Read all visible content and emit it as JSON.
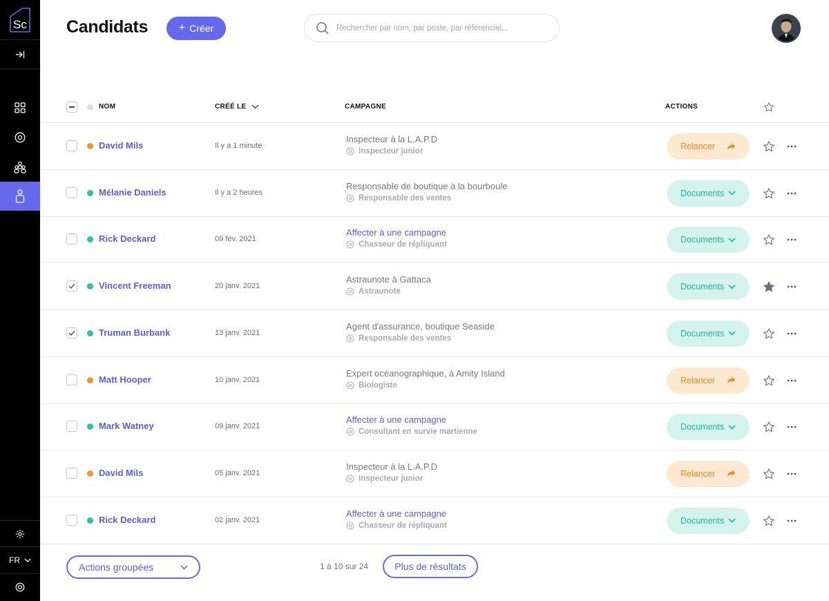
{
  "app": {
    "logo_text": "Sc",
    "page_title": "Candidats",
    "create_label": "Créer",
    "search_placeholder": "Rechercher par nom, par poste, par référenciel..."
  },
  "sidebar": {
    "items": [
      {
        "icon": "dashboard-icon",
        "active": false
      },
      {
        "icon": "target-icon",
        "active": false
      },
      {
        "icon": "team-icon",
        "active": false
      },
      {
        "icon": "candidate-icon",
        "active": true
      }
    ],
    "settings_icon": "settings-icon",
    "language": "FR",
    "support_icon": "support-icon"
  },
  "table": {
    "headers": {
      "name": "NOM",
      "created": "CRÉÉ LE",
      "campaign": "CAMPAGNE",
      "actions": "ACTIONS"
    },
    "rows": [
      {
        "checked": false,
        "status": "orange",
        "name": "David Mils",
        "created": "Il y a 1 minute",
        "campaign": "Inspecteur à la L.A.P.D",
        "campaign_link": false,
        "role": "Inspecteur junior",
        "action": "Relancer",
        "action_type": "relancer",
        "starred": false
      },
      {
        "checked": false,
        "status": "teal",
        "name": "Mélanie Daniels",
        "created": "Il y a 2 heures",
        "campaign": "Responsable de boutique à la bourboule",
        "campaign_link": false,
        "role": "Responsable des ventes",
        "action": "Documents",
        "action_type": "documents",
        "starred": false
      },
      {
        "checked": false,
        "status": "teal",
        "name": "Rick Deckard",
        "created": "09 fév. 2021",
        "campaign": "Affecter à une campagne",
        "campaign_link": true,
        "role": "Chasseur de répliquant",
        "action": "Documents",
        "action_type": "documents",
        "starred": false
      },
      {
        "checked": true,
        "status": "teal",
        "name": "Vincent Freeman",
        "created": "20 janv. 2021",
        "campaign": "Astraunote à Gattaca",
        "campaign_link": false,
        "role": "Astraunote",
        "action": "Documents",
        "action_type": "documents",
        "starred": true
      },
      {
        "checked": true,
        "status": "teal",
        "name": "Truman Burbank",
        "created": "13 janv. 2021",
        "campaign": "Agent d'assurance, boutique Seaside",
        "campaign_link": false,
        "role": "Responsable des ventes",
        "action": "Documents",
        "action_type": "documents",
        "starred": false
      },
      {
        "checked": false,
        "status": "orange",
        "name": "Matt Hooper",
        "created": "10 janv. 2021",
        "campaign": "Expert océanographique, à Amity Island",
        "campaign_link": false,
        "role": "Biologiste",
        "action": "Relancer",
        "action_type": "relancer",
        "starred": false
      },
      {
        "checked": false,
        "status": "teal",
        "name": "Mark Watney",
        "created": "09 janv. 2021",
        "campaign": "Affecter à une campagne",
        "campaign_link": true,
        "role": "Consultant en survie martienne",
        "action": "Documents",
        "action_type": "documents",
        "starred": false
      },
      {
        "checked": false,
        "status": "orange",
        "name": "David Mils",
        "created": "05 janv. 2021",
        "campaign": "Inspecteur à la L.A.P.D",
        "campaign_link": false,
        "role": "Inspecteur junior",
        "action": "Relancer",
        "action_type": "relancer",
        "starred": false
      },
      {
        "checked": false,
        "status": "teal",
        "name": "Rick Deckard",
        "created": "02 janv. 2021",
        "campaign": "Affecter à une campagne",
        "campaign_link": true,
        "role": "Chasseur de répliquant",
        "action": "Documents",
        "action_type": "documents",
        "starred": false
      }
    ]
  },
  "footer": {
    "group_actions_label": "Actions groupées",
    "pagination_text": "1 à 10 sur 24",
    "more_results_label": "Plus de résultats"
  },
  "colors": {
    "accent": "#6469ec",
    "orange": "#f0962e",
    "teal": "#2bc3a6",
    "orange_bg": "#fde8d2",
    "teal_bg": "#d5f3ed"
  }
}
